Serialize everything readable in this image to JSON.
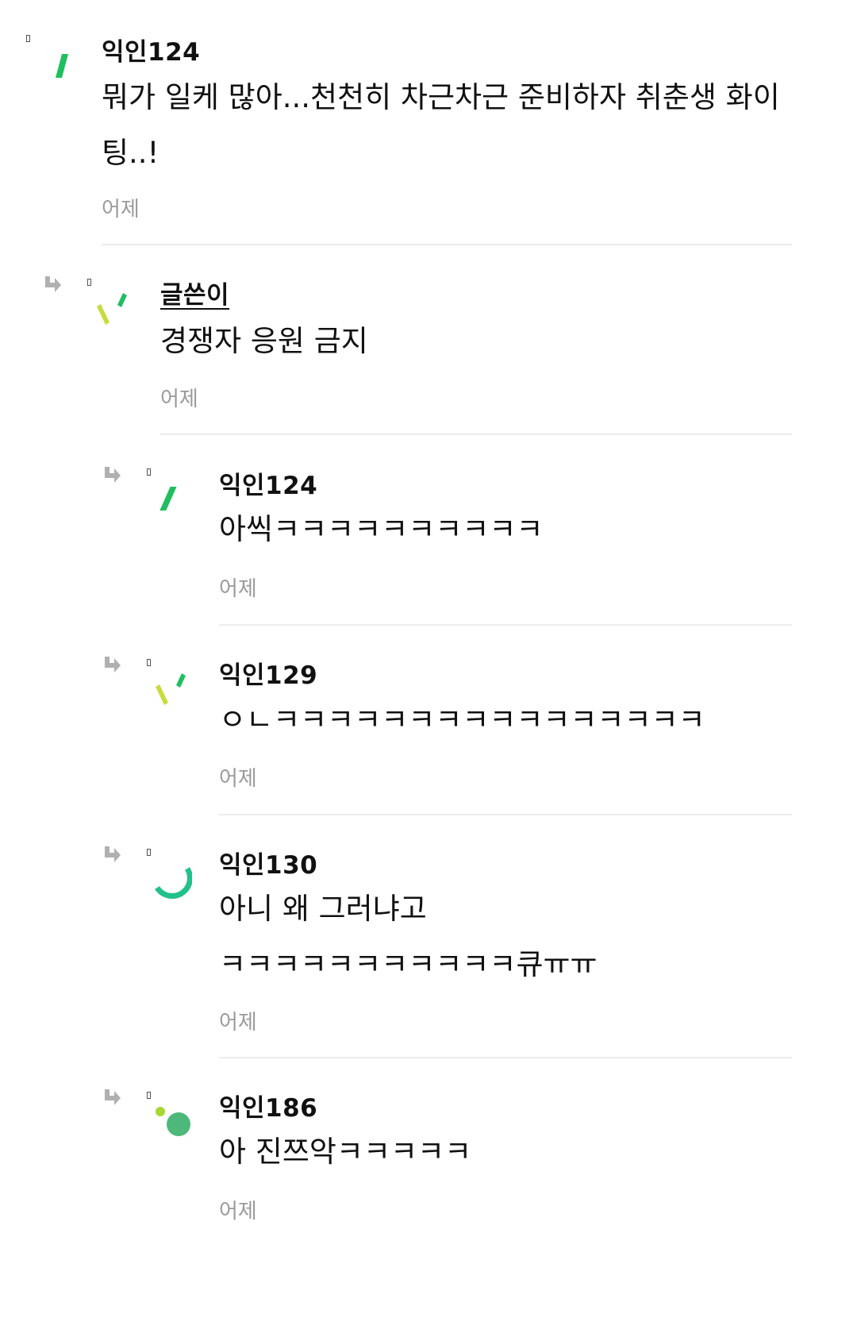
{
  "comments": [
    {
      "author": "익인124",
      "body": "뭐가 일케 많아...천천히 차근차근 준비하자 취춘생 화이팅..!",
      "time": "어제",
      "avatar_icon": "green-slash-icon"
    },
    {
      "author": "글쓴이",
      "body": "경쟁자 응원 금지",
      "time": "어제",
      "avatar_icon": "check-strokes-icon"
    },
    {
      "author": "익인124",
      "body": "아씩ㅋㅋㅋㅋㅋㅋㅋㅋㅋㅋ",
      "time": "어제",
      "avatar_icon": "green-slash-icon"
    },
    {
      "author": "익인129",
      "body": "ㅇㄴㅋㅋㅋㅋㅋㅋㅋㅋㅋㅋㅋㅋㅋㅋㅋㅋ",
      "time": "어제",
      "avatar_icon": "check-strokes-icon"
    },
    {
      "author": "익인130",
      "body": "아니 왜 그러냐고\nㅋㅋㅋㅋㅋㅋㅋㅋㅋㅋㅋ큐ㅠㅠ",
      "time": "어제",
      "avatar_icon": "green-arc-icon"
    },
    {
      "author": "익인186",
      "body": "아 진쯔악ㅋㅋㅋㅋㅋ",
      "time": "어제",
      "avatar_icon": "green-dots-icon"
    }
  ],
  "colors": {
    "green_dark": "#1fbf5f",
    "green_light": "#c8dc3c",
    "green_arc": "#22c08a",
    "green_dot_big": "#4db87a",
    "green_dot_small": "#a6d834",
    "time_gray": "#9a9a9a",
    "divider": "#ececec"
  }
}
